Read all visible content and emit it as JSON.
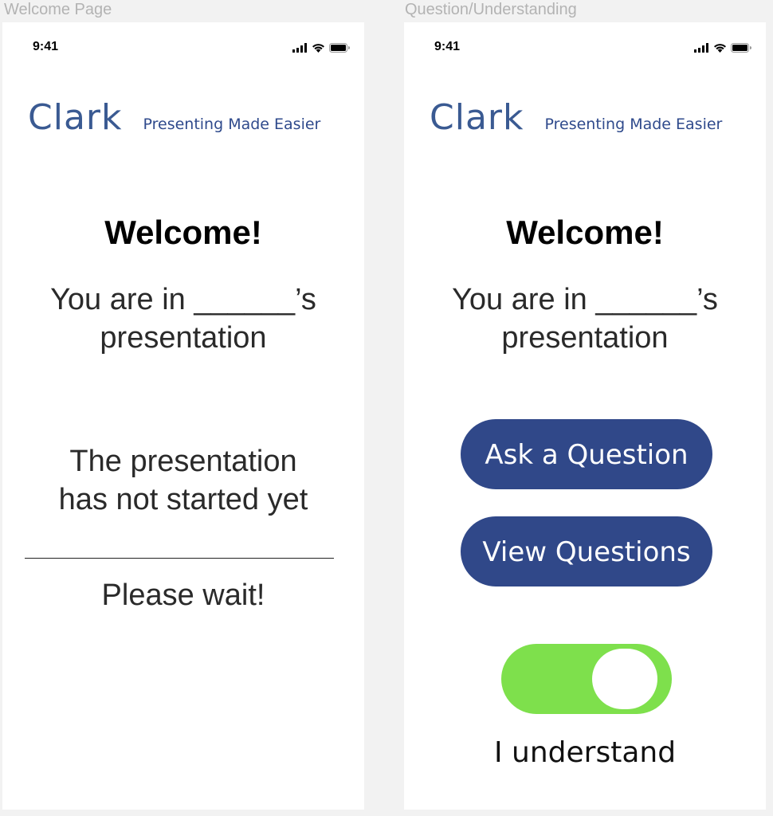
{
  "frames": [
    {
      "label": "Welcome Page",
      "status_bar": {
        "time": "9:41"
      },
      "brand": {
        "name": "Clark",
        "tagline": "Presenting Made Easier"
      },
      "welcome_title": "Welcome!",
      "presenter_line_1": "You are in ______’s",
      "presenter_line_2": "presentation",
      "status_line_1": "The presentation",
      "status_line_2": "has not started yet",
      "wait_message": "Please wait!"
    },
    {
      "label": "Question/Understanding",
      "status_bar": {
        "time": "9:41"
      },
      "brand": {
        "name": "Clark",
        "tagline": "Presenting Made Easier"
      },
      "welcome_title": "Welcome!",
      "presenter_line_1": "You are in ______’s",
      "presenter_line_2": "presentation",
      "ask_button": "Ask a Question",
      "view_button": "View Questions",
      "understand_toggle": {
        "on": true,
        "label": "I understand"
      }
    }
  ],
  "colors": {
    "brand": "#3a5a92",
    "button": "#304889",
    "toggle_on": "#7ee04c"
  },
  "icons": [
    "signal-icon",
    "wifi-icon",
    "battery-icon"
  ]
}
